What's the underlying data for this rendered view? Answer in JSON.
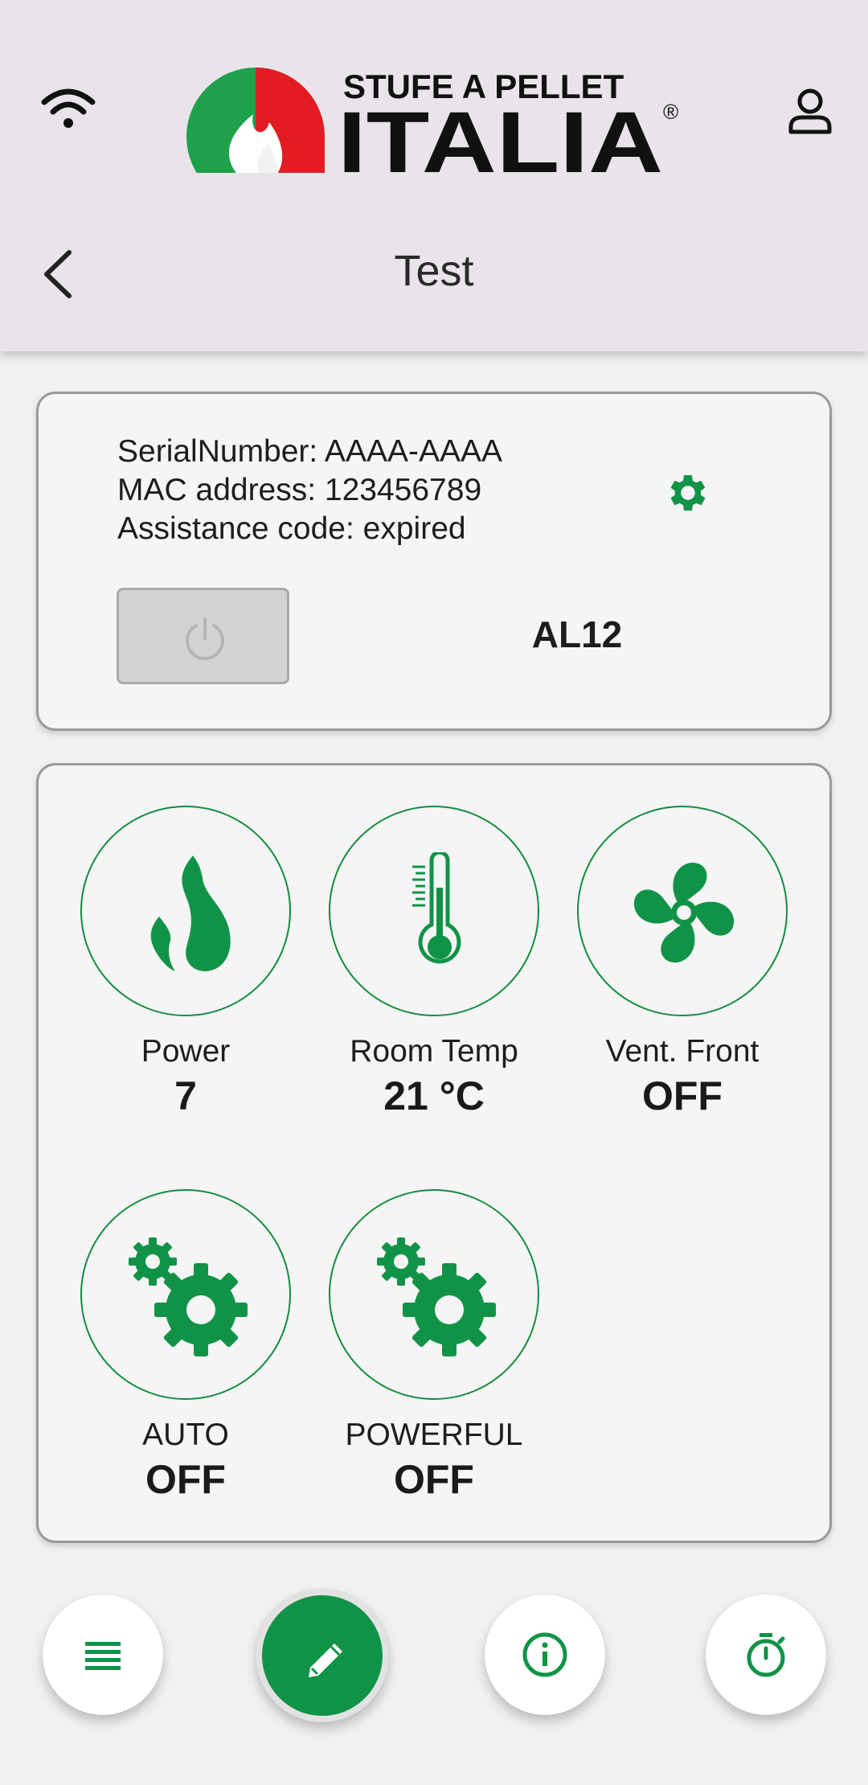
{
  "colors": {
    "accent": "#119347",
    "header_bg": "#e8e4e9",
    "logo_red": "#e31b23",
    "logo_green": "#1ea14a"
  },
  "header": {
    "logo_top_text": "STUFE A PELLET",
    "logo_main_text": "ITALIA",
    "logo_mark": "®",
    "title": "Test"
  },
  "device": {
    "serial_line": "SerialNumber: AAAA-AAAA",
    "mac_line": "MAC address: 123456789",
    "assistance_line": "Assistance code: expired",
    "status_code": "AL12"
  },
  "tiles": [
    {
      "icon": "flame-icon",
      "label": "Power",
      "value": "7"
    },
    {
      "icon": "thermometer-icon",
      "label": "Room Temp",
      "value": "21 °C"
    },
    {
      "icon": "fan-icon",
      "label": "Vent. Front",
      "value": "OFF"
    },
    {
      "icon": "gears-icon",
      "label": "AUTO",
      "value": "OFF"
    },
    {
      "icon": "gears-icon",
      "label": "POWERFUL",
      "value": "OFF"
    }
  ],
  "bottom_nav": [
    {
      "icon": "list-icon",
      "active": false
    },
    {
      "icon": "pencil-icon",
      "active": true
    },
    {
      "icon": "info-icon",
      "active": false
    },
    {
      "icon": "timer-icon",
      "active": false
    }
  ]
}
